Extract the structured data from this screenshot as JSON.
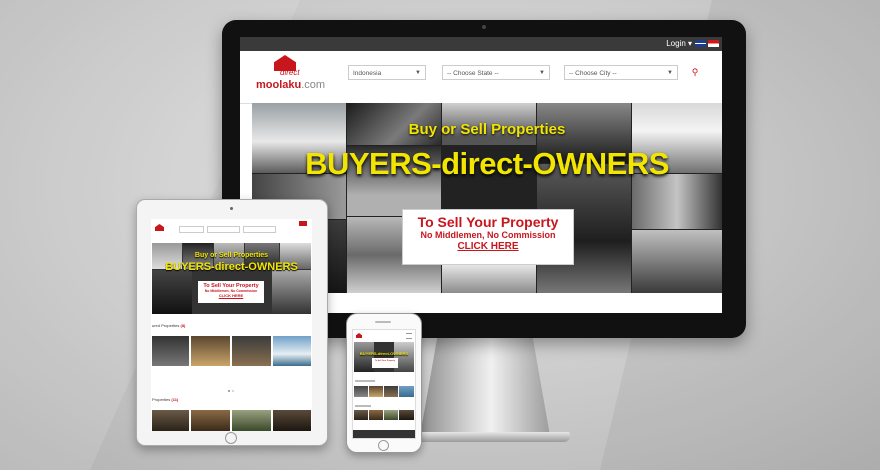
{
  "site": {
    "logo_tag": "direct",
    "logo_name": "moolaku",
    "logo_tld": ".com",
    "brand_color": "#c8161d",
    "highlight_color": "#f2e600"
  },
  "topbar": {
    "login_label": "Login ▾",
    "flags": [
      "uk-flag-icon",
      "indonesia-flag-icon"
    ]
  },
  "search": {
    "country": "Indonesia",
    "state": "-- Choose State --",
    "city": "-- Choose City --",
    "icon": "search-icon"
  },
  "hero": {
    "subtitle": "Buy or Sell Properties",
    "title": "BUYERS-direct-OWNERS",
    "cta_line1": "To Sell Your Property",
    "cta_line2": "No Middlemen, No Commission",
    "cta_link": "CLICK HERE"
  },
  "ipad": {
    "section1": "ured Properties",
    "section1_count": "(8)",
    "section2": "Properties",
    "section2_count": "(11)"
  }
}
